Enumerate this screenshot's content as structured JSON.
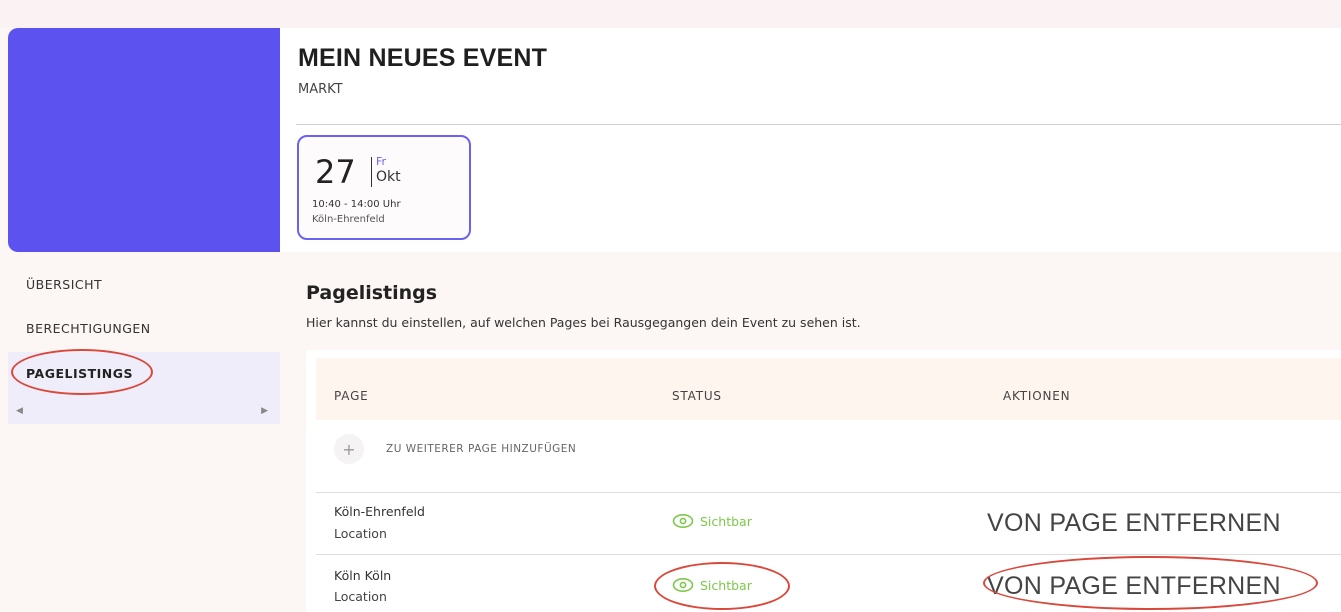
{
  "event": {
    "title": "MEIN NEUES EVENT",
    "subtitle": "MARKT",
    "date": {
      "day": "27",
      "weekday": "Fr",
      "month": "Okt",
      "time": "10:40 - 14:00 Uhr",
      "location": "Köln-Ehrenfeld"
    }
  },
  "sidebar": {
    "items": [
      {
        "label": "ÜBERSICHT"
      },
      {
        "label": "BERECHTIGUNGEN"
      },
      {
        "label": "PAGELISTINGS"
      }
    ]
  },
  "section": {
    "title": "Pagelistings",
    "description": "Hier kannst du einstellen, auf welchen Pages bei Rausgegangen dein Event zu sehen ist."
  },
  "table": {
    "headers": [
      "PAGE",
      "STATUS",
      "AKTIONEN"
    ],
    "add_label": "ZU WEITERER PAGE HINZUFÜGEN",
    "add_icon": "+",
    "rows": [
      {
        "name": "Köln-Ehrenfeld",
        "type": "Location",
        "status": "Sichtbar",
        "action": "VON PAGE ENTFERNEN"
      },
      {
        "name": "Köln Köln",
        "type": "Location",
        "status": "Sichtbar",
        "action": "VON PAGE ENTFERNEN"
      }
    ]
  },
  "colors": {
    "accent": "#5b52ef",
    "visible_status": "#7cc94a",
    "annotation": "#d9483b"
  }
}
